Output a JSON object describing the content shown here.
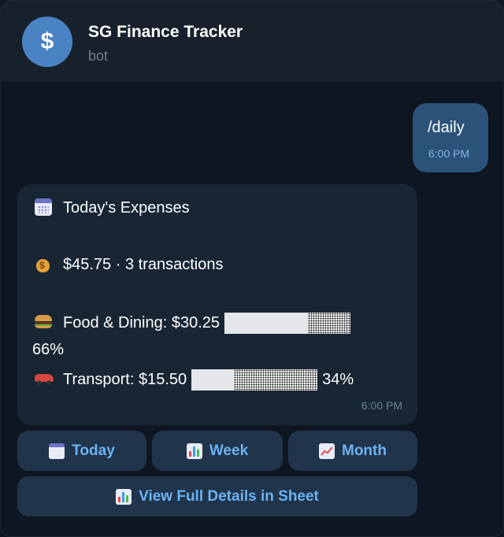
{
  "header": {
    "avatar_symbol": "$",
    "title": "SG Finance Tracker",
    "subtitle": "bot"
  },
  "outgoing": {
    "text": "/daily",
    "time": "6:00 PM"
  },
  "incoming": {
    "heading": "Today's Expenses",
    "heading_icon": "calendar-icon",
    "summary": "$45.75 · 3 transactions",
    "summary_icon": "money-bag-icon",
    "categories": [
      {
        "icon": "burger-icon",
        "label": "Food & Dining: $30.25",
        "percent_text": "66%",
        "percent": 66
      },
      {
        "icon": "car-icon",
        "label": "Transport: $15.50",
        "percent_text": "34%",
        "percent": 34
      }
    ],
    "time": "6:00 PM"
  },
  "keyboard": {
    "today_label": "Today",
    "week_label": "Week",
    "month_label": "Month",
    "sheet_label": "View Full Details in Sheet"
  },
  "colors": {
    "background": "#0e1621",
    "header": "#17212b",
    "outgoing_bubble": "#2b5278",
    "incoming_bubble": "#182533",
    "button": "#20344b",
    "accent": "#6ab2f2"
  }
}
